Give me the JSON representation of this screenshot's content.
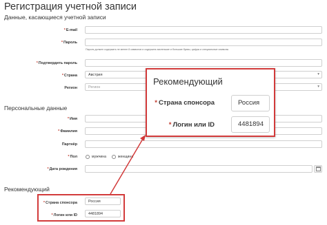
{
  "page": {
    "title": "Регистрация учетной записи"
  },
  "sections": {
    "account": "Данные, касающиеся учетной записи",
    "personal": "Персональные данные",
    "referrer": "Рекомендующий"
  },
  "account": {
    "email_label": "E-mail",
    "password_label": "Пароль",
    "password_hint": "Пароль должен содержать не менее 8 символов и содержать маленькие и большие буквы, цифры и специальные символы",
    "confirm_label": "Подтвердить пароль",
    "country_label": "Страна",
    "country_value": "Австрия",
    "region_label": "Регион",
    "region_value": "Регион"
  },
  "personal": {
    "first_name_label": "Имя",
    "last_name_label": "Фамилия",
    "partner_label": "Партнёр",
    "gender_label": "Пол",
    "gender_options": [
      "мужчина",
      "женщина"
    ],
    "birthdate_label": "Дата рождения"
  },
  "referrer": {
    "sponsor_country_label": "Страна спонсора",
    "sponsor_country_value": "Россия",
    "login_label": "Логин или ID",
    "login_value": "4481894"
  },
  "zoom": {
    "title": "Рекомендующий",
    "sponsor_country_label": "Страна спонсора",
    "sponsor_country_value": "Россия",
    "login_label": "Логин или ID",
    "login_value": "4481894"
  },
  "colors": {
    "highlight": "#d23a3a",
    "required": "#c0392b",
    "border": "#cfcfcf"
  },
  "icons": [
    "select-arrow-icon",
    "calendar-icon",
    "callout-arrow-icon"
  ]
}
